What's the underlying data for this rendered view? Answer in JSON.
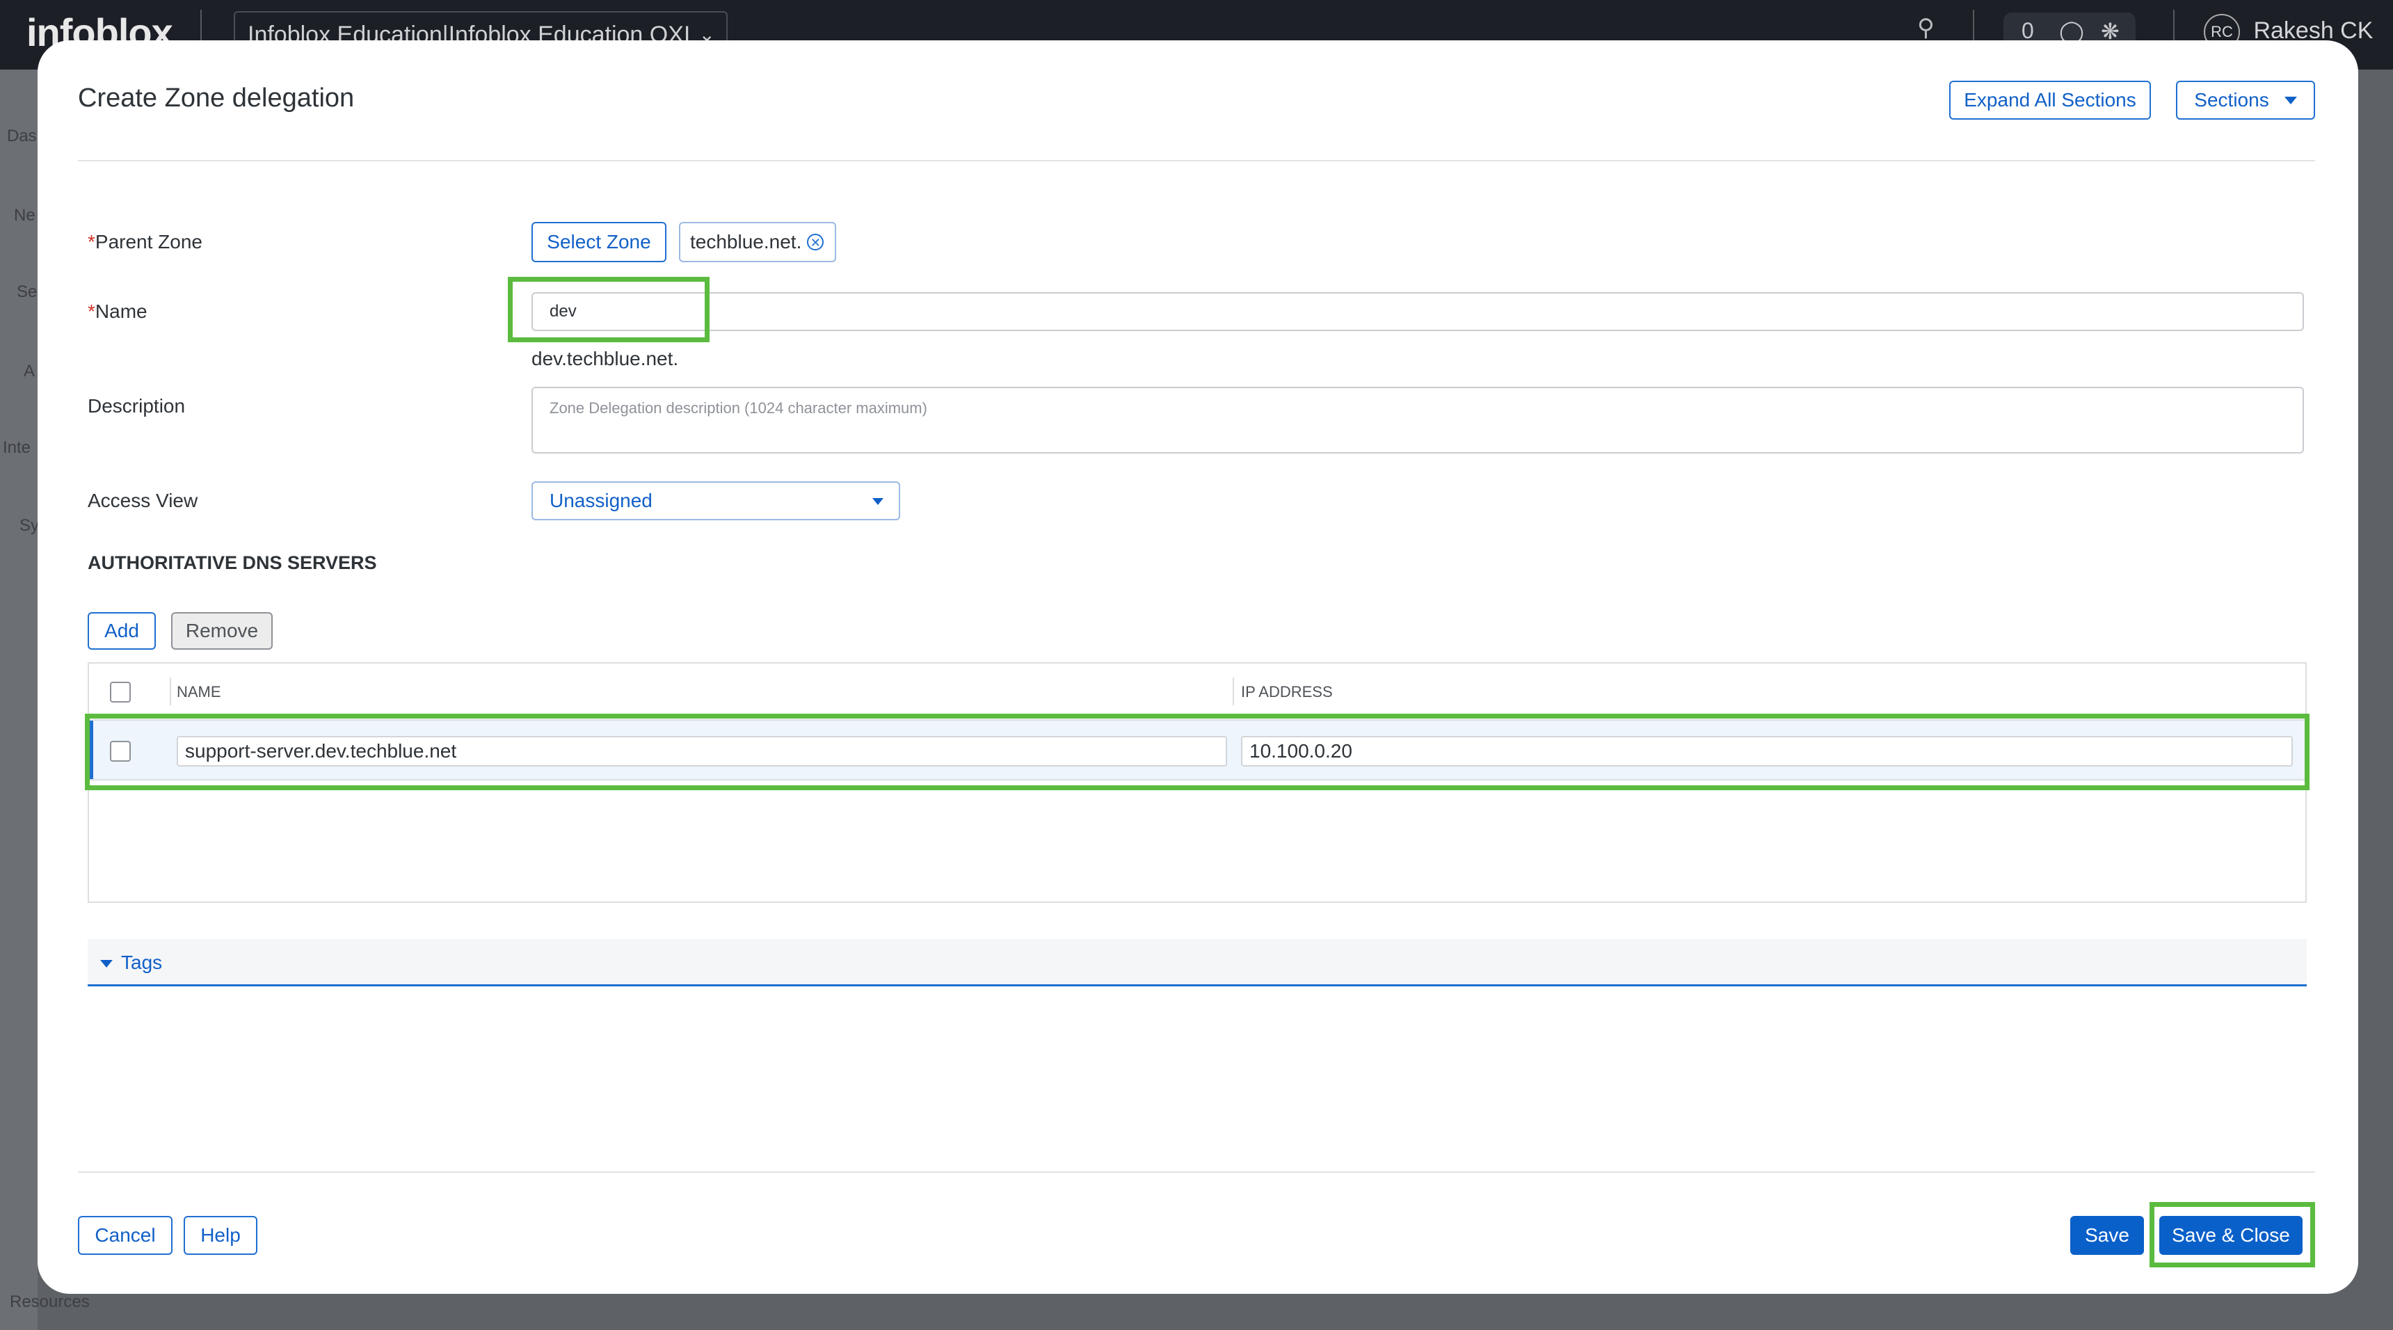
{
  "app": {
    "logo": "infoblox",
    "context": "Infoblox Education|Infoblox Education OXI",
    "notifications_count": "0",
    "user_initials": "RC",
    "user_name": "Rakesh CK"
  },
  "background": {
    "sidebar_fragments": [
      "Das",
      "Ne",
      "Se",
      "A",
      "Inte",
      "Sy",
      "Resources"
    ]
  },
  "modal": {
    "title": "Create Zone delegation",
    "expand_all_label": "Expand All Sections",
    "sections_label": "Sections"
  },
  "form": {
    "parent_zone": {
      "label": "Parent Zone",
      "required_mark": "*",
      "select_button": "Select Zone",
      "selected_zone": "techblue.net."
    },
    "name": {
      "label": "Name",
      "required_mark": "*",
      "value": "dev",
      "fqdn_hint": "dev.techblue.net."
    },
    "description": {
      "label": "Description",
      "placeholder": "Zone Delegation description (1024 character maximum)",
      "value": ""
    },
    "access_view": {
      "label": "Access View",
      "selected": "Unassigned"
    }
  },
  "dns_servers": {
    "heading": "AUTHORITATIVE DNS SERVERS",
    "add_label": "Add",
    "remove_label": "Remove",
    "columns": [
      "NAME",
      "IP ADDRESS"
    ],
    "rows": [
      {
        "name": "support-server.dev.techblue.net",
        "ip": "10.100.0.20"
      }
    ]
  },
  "tags": {
    "label": "Tags"
  },
  "footer": {
    "cancel_label": "Cancel",
    "help_label": "Help",
    "save_label": "Save",
    "save_close_label": "Save & Close"
  },
  "colors": {
    "accent": "#0a60c9",
    "highlight": "#5bbb3f",
    "required": "#d0342c"
  }
}
